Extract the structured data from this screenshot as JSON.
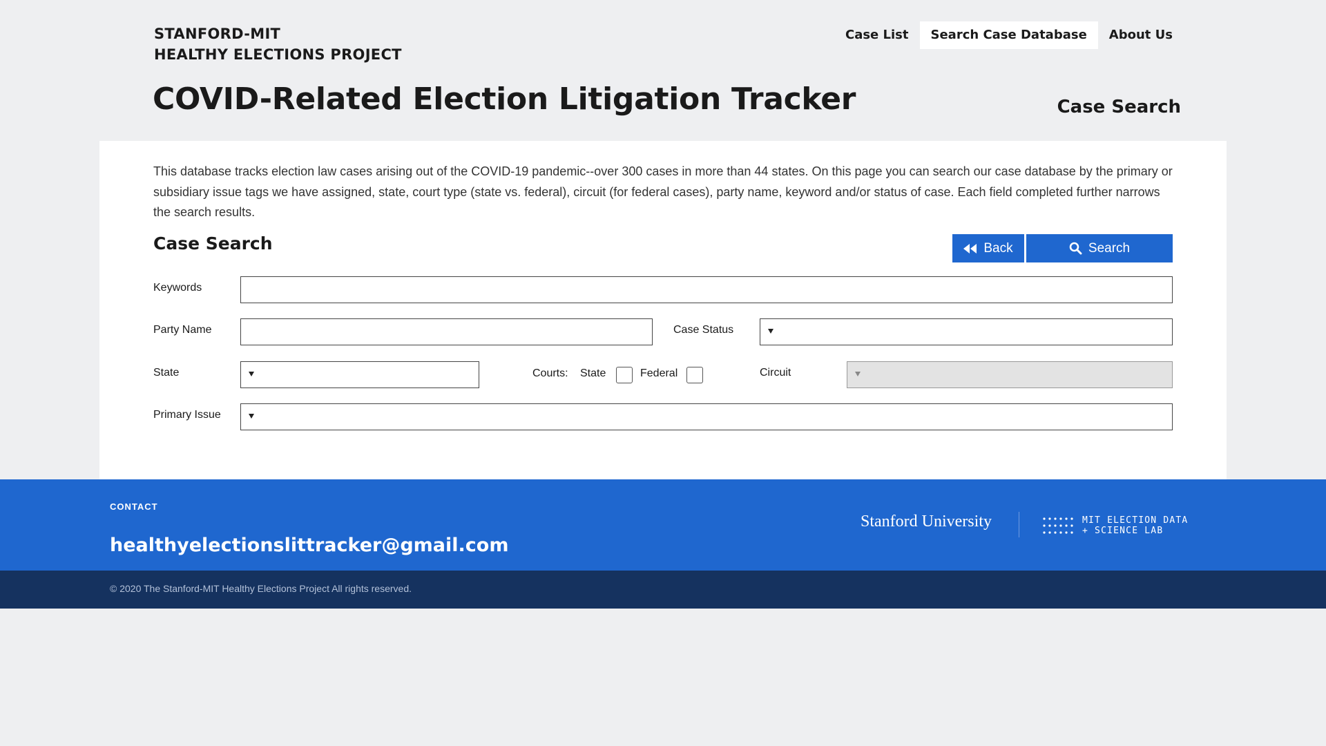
{
  "header": {
    "brand_line1": "STANFORD-MIT",
    "brand_line2": "HEALTHY ELECTIONS PROJECT",
    "nav": [
      {
        "label": "Case List",
        "active": false
      },
      {
        "label": "Search Case Database",
        "active": true
      },
      {
        "label": "About Us",
        "active": false
      }
    ],
    "title": "COVID-Related Election Litigation Tracker",
    "subtitle": "Case Search"
  },
  "main": {
    "intro": "This database tracks election law cases arising out of the COVID-19 pandemic--over 300 cases in more than 44 states. On this page you can search our case database by the primary or subsidiary issue tags we have assigned, state, court type (state vs. federal), circuit (for federal cases), party name, keyword and/or status of case. Each field completed further narrows the search results.",
    "section_title": "Case Search",
    "buttons": {
      "back": "Back",
      "search": "Search"
    },
    "form": {
      "keywords_label": "Keywords",
      "keywords_value": "",
      "party_label": "Party Name",
      "party_value": "",
      "status_label": "Case Status",
      "status_value": "",
      "state_label": "State",
      "state_value": "",
      "courts_label": "Courts:",
      "court_state_label": "State",
      "court_state_checked": false,
      "court_federal_label": "Federal",
      "court_federal_checked": false,
      "circuit_label": "Circuit",
      "circuit_value": "",
      "circuit_disabled": true,
      "primary_label": "Primary Issue",
      "primary_value": ""
    }
  },
  "footer": {
    "contact_label": "CONTACT",
    "email": "healthyelectionslittracker@gmail.com",
    "stanford": "Stanford University",
    "mit_line1": "MIT ELECTION DATA",
    "mit_line2": "+ SCIENCE LAB",
    "copyright": "© 2020 The Stanford-MIT Healthy Elections Project All rights reserved."
  },
  "colors": {
    "accent": "#1f67cf",
    "footer_bottom": "#15325f",
    "page_bg": "#eeeff1"
  }
}
